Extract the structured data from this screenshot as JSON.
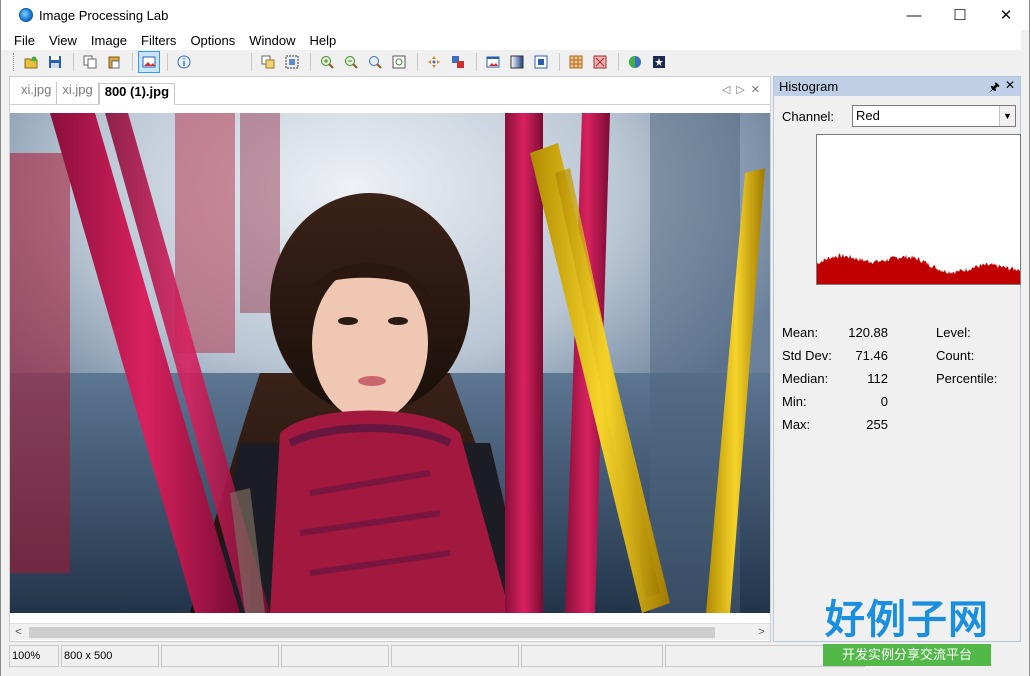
{
  "window": {
    "title": "Image Processing Lab",
    "controls": {
      "minimize": "—",
      "maximize": "☐",
      "close": "✕"
    }
  },
  "menu": [
    "File",
    "View",
    "Image",
    "Filters",
    "Options",
    "Window",
    "Help"
  ],
  "tabs": [
    {
      "label": "xi.jpg",
      "active": false
    },
    {
      "label": "xi.jpg",
      "active": false
    },
    {
      "label": "800 (1).jpg",
      "active": true
    }
  ],
  "tab_nav": {
    "prev": "◁",
    "next": "▷",
    "close": "✕"
  },
  "histogram": {
    "title": "Histogram",
    "pin": "🖈",
    "close": "✕",
    "channel_label": "Channel:",
    "channel_value": "Red",
    "stats": [
      {
        "label": "Mean:",
        "value": "120.88",
        "label2": "Level:"
      },
      {
        "label": "Std Dev:",
        "value": "71.46",
        "label2": "Count:"
      },
      {
        "label": "Median:",
        "value": "112",
        "label2": "Percentile:"
      },
      {
        "label": "Min:",
        "value": "0",
        "label2": ""
      },
      {
        "label": "Max:",
        "value": "255",
        "label2": ""
      }
    ],
    "fill_color": "#c00000"
  },
  "statusbar": {
    "zoom": "100%",
    "size": "800 x 500"
  },
  "brand": {
    "main": "好例子网",
    "sub": "开发实例分享交流平台"
  },
  "colors": {
    "accent": "#3399ff",
    "panel_header": "#bfd0e6",
    "brand_blue": "#1a8fe0",
    "brand_green": "#52b848"
  }
}
